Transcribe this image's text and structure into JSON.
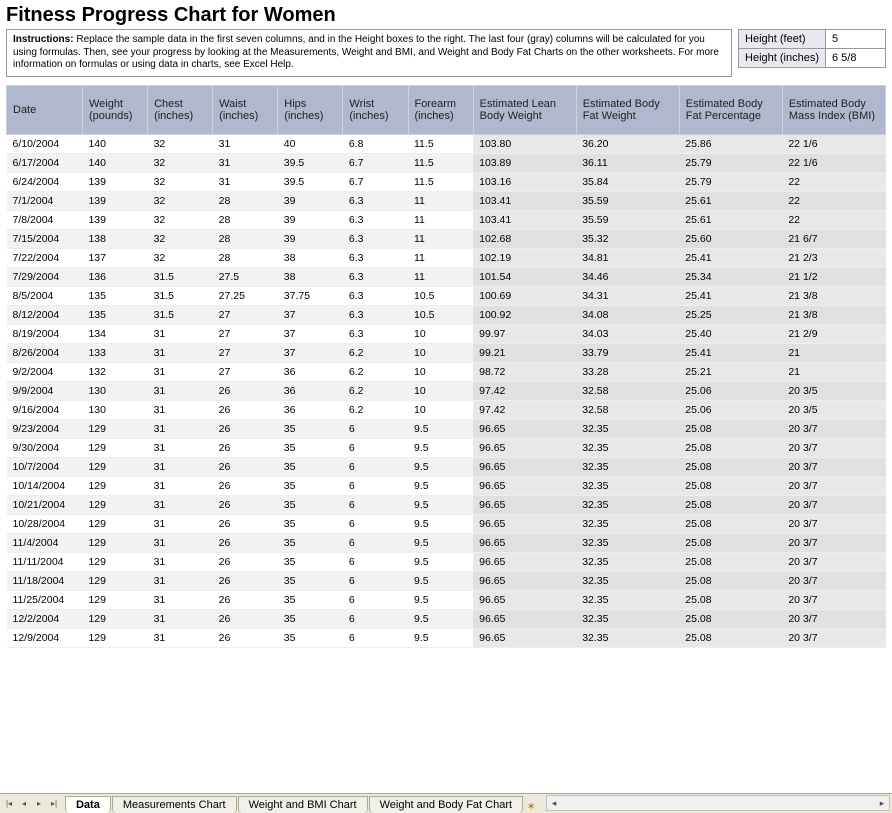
{
  "title": "Fitness Progress Chart for Women",
  "instructions_label": "Instructions:",
  "instructions_text": "Replace the sample data in the first seven columns, and in the Height boxes to the right. The last four (gray) columns will be calculated for you using formulas. Then, see your progress by looking at the Measurements, Weight and BMI, and Weight and Body Fat Charts on the other worksheets. For more information on formulas or using data in charts, see Excel Help.",
  "height": {
    "feet_label": "Height (feet)",
    "feet_value": "5",
    "inches_label": "Height (inches)",
    "inches_value": "6 5/8"
  },
  "columns": [
    "Date",
    "Weight (pounds)",
    "Chest (inches)",
    "Waist (inches)",
    "Hips (inches)",
    "Wrist (inches)",
    "Forearm (inches)",
    "Estimated Lean Body Weight",
    "Estimated Body Fat Weight",
    "Estimated Body Fat Percentage",
    "Estimated Body Mass Index (BMI)"
  ],
  "rows": [
    [
      "6/10/2004",
      "140",
      "32",
      "31",
      "40",
      "6.8",
      "11.5",
      "103.80",
      "36.20",
      "25.86",
      "22 1/6"
    ],
    [
      "6/17/2004",
      "140",
      "32",
      "31",
      "39.5",
      "6.7",
      "11.5",
      "103.89",
      "36.11",
      "25.79",
      "22 1/6"
    ],
    [
      "6/24/2004",
      "139",
      "32",
      "31",
      "39.5",
      "6.7",
      "11.5",
      "103.16",
      "35.84",
      "25.79",
      "22"
    ],
    [
      "7/1/2004",
      "139",
      "32",
      "28",
      "39",
      "6.3",
      "11",
      "103.41",
      "35.59",
      "25.61",
      "22"
    ],
    [
      "7/8/2004",
      "139",
      "32",
      "28",
      "39",
      "6.3",
      "11",
      "103.41",
      "35.59",
      "25.61",
      "22"
    ],
    [
      "7/15/2004",
      "138",
      "32",
      "28",
      "39",
      "6.3",
      "11",
      "102.68",
      "35.32",
      "25.60",
      "21 6/7"
    ],
    [
      "7/22/2004",
      "137",
      "32",
      "28",
      "38",
      "6.3",
      "11",
      "102.19",
      "34.81",
      "25.41",
      "21 2/3"
    ],
    [
      "7/29/2004",
      "136",
      "31.5",
      "27.5",
      "38",
      "6.3",
      "11",
      "101.54",
      "34.46",
      "25.34",
      "21 1/2"
    ],
    [
      "8/5/2004",
      "135",
      "31.5",
      "27.25",
      "37.75",
      "6.3",
      "10.5",
      "100.69",
      "34.31",
      "25.41",
      "21 3/8"
    ],
    [
      "8/12/2004",
      "135",
      "31.5",
      "27",
      "37",
      "6.3",
      "10.5",
      "100.92",
      "34.08",
      "25.25",
      "21 3/8"
    ],
    [
      "8/19/2004",
      "134",
      "31",
      "27",
      "37",
      "6.3",
      "10",
      "99.97",
      "34.03",
      "25.40",
      "21 2/9"
    ],
    [
      "8/26/2004",
      "133",
      "31",
      "27",
      "37",
      "6.2",
      "10",
      "99.21",
      "33.79",
      "25.41",
      "21"
    ],
    [
      "9/2/2004",
      "132",
      "31",
      "27",
      "36",
      "6.2",
      "10",
      "98.72",
      "33.28",
      "25.21",
      "21"
    ],
    [
      "9/9/2004",
      "130",
      "31",
      "26",
      "36",
      "6.2",
      "10",
      "97.42",
      "32.58",
      "25.06",
      "20 3/5"
    ],
    [
      "9/16/2004",
      "130",
      "31",
      "26",
      "36",
      "6.2",
      "10",
      "97.42",
      "32.58",
      "25.06",
      "20 3/5"
    ],
    [
      "9/23/2004",
      "129",
      "31",
      "26",
      "35",
      "6",
      "9.5",
      "96.65",
      "32.35",
      "25.08",
      "20 3/7"
    ],
    [
      "9/30/2004",
      "129",
      "31",
      "26",
      "35",
      "6",
      "9.5",
      "96.65",
      "32.35",
      "25.08",
      "20 3/7"
    ],
    [
      "10/7/2004",
      "129",
      "31",
      "26",
      "35",
      "6",
      "9.5",
      "96.65",
      "32.35",
      "25.08",
      "20 3/7"
    ],
    [
      "10/14/2004",
      "129",
      "31",
      "26",
      "35",
      "6",
      "9.5",
      "96.65",
      "32.35",
      "25.08",
      "20 3/7"
    ],
    [
      "10/21/2004",
      "129",
      "31",
      "26",
      "35",
      "6",
      "9.5",
      "96.65",
      "32.35",
      "25.08",
      "20 3/7"
    ],
    [
      "10/28/2004",
      "129",
      "31",
      "26",
      "35",
      "6",
      "9.5",
      "96.65",
      "32.35",
      "25.08",
      "20 3/7"
    ],
    [
      "11/4/2004",
      "129",
      "31",
      "26",
      "35",
      "6",
      "9.5",
      "96.65",
      "32.35",
      "25.08",
      "20 3/7"
    ],
    [
      "11/11/2004",
      "129",
      "31",
      "26",
      "35",
      "6",
      "9.5",
      "96.65",
      "32.35",
      "25.08",
      "20 3/7"
    ],
    [
      "11/18/2004",
      "129",
      "31",
      "26",
      "35",
      "6",
      "9.5",
      "96.65",
      "32.35",
      "25.08",
      "20 3/7"
    ],
    [
      "11/25/2004",
      "129",
      "31",
      "26",
      "35",
      "6",
      "9.5",
      "96.65",
      "32.35",
      "25.08",
      "20 3/7"
    ],
    [
      "12/2/2004",
      "129",
      "31",
      "26",
      "35",
      "6",
      "9.5",
      "96.65",
      "32.35",
      "25.08",
      "20 3/7"
    ],
    [
      "12/9/2004",
      "129",
      "31",
      "26",
      "35",
      "6",
      "9.5",
      "96.65",
      "32.35",
      "25.08",
      "20 3/7"
    ]
  ],
  "tabs": {
    "data": "Data",
    "measurements": "Measurements Chart",
    "weight_bmi": "Weight and BMI Chart",
    "weight_fat": "Weight and Body Fat Chart"
  }
}
